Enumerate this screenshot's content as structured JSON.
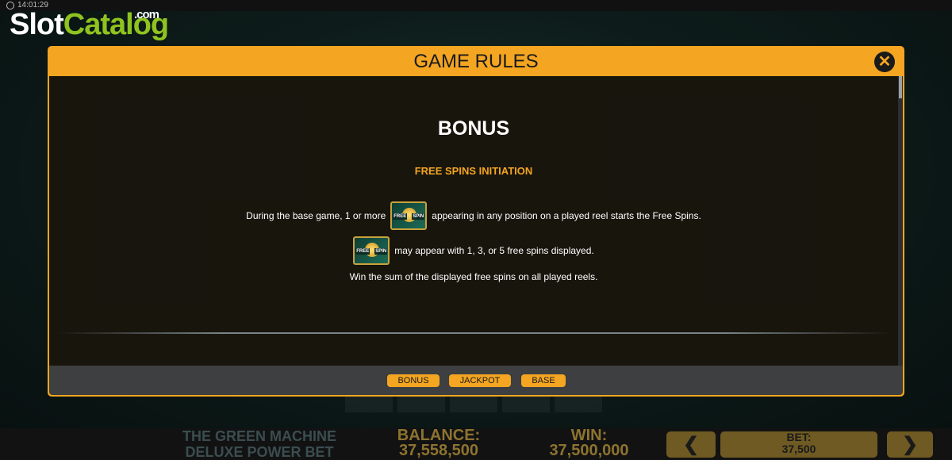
{
  "status_bar": {
    "time": "14:01:29"
  },
  "logo": {
    "slot": "Slot",
    "catalog": "Catalog",
    "com": ".com"
  },
  "modal": {
    "title": "GAME RULES",
    "close_label": "✕",
    "section_heading": "BONUS",
    "subsection_heading": "FREE SPINS INITIATION",
    "lines": {
      "line1_pre": "During the base game, 1 or more",
      "line1_post": "appearing in any position on a played reel starts the Free Spins.",
      "line2_post": "may appear with 1, 3, or 5 free spins displayed.",
      "line3": "Win the sum of the displayed free spins on all played reels."
    },
    "symbol_text": {
      "left": "FREE",
      "right": "SPIN"
    },
    "footer_tabs": [
      {
        "label": "BONUS"
      },
      {
        "label": "JACKPOT"
      },
      {
        "label": "BASE"
      }
    ]
  },
  "bottom_bar": {
    "game_name_line1": "THE GREEN MACHINE",
    "game_name_line2": "DELUXE POWER BET",
    "balance_label": "BALANCE:",
    "balance_value": "37,558,500",
    "win_label": "WIN:",
    "win_value": "37,500,000",
    "bet_label": "BET:",
    "bet_value": "37,500",
    "prev_arrow": "❮",
    "next_arrow": "❯"
  },
  "colors": {
    "accent": "#f4a521",
    "modal_body": "#060a0c",
    "footer": "#3d3f41",
    "logo_green": "#8fc31f"
  }
}
